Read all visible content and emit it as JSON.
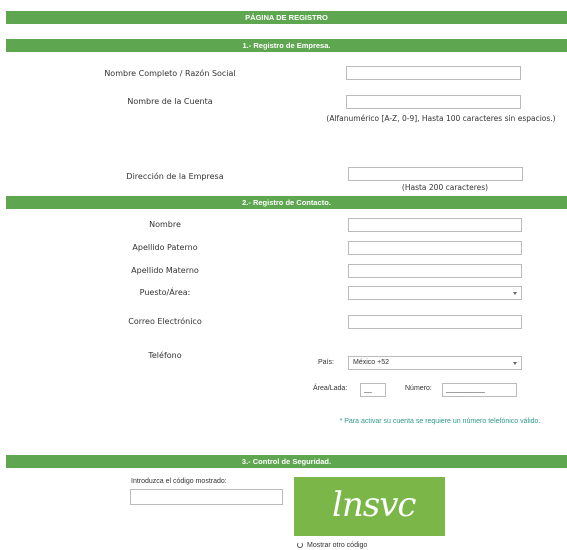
{
  "header": {
    "title": "PÁGINA DE REGISTRO"
  },
  "section1": {
    "title": "1.- Registro de Empresa.",
    "razon_social_label": "Nombre Completo / Razón Social",
    "cuenta_label": "Nombre de la Cuenta",
    "cuenta_hint": "(Alfanumérico [A-Z, 0-9], Hasta 100 caracteres sin espacios.)",
    "direccion_label": "Dirección de la Empresa",
    "direccion_hint": "(Hasta 200 caracteres)"
  },
  "section2": {
    "title": "2.- Registro de Contacto.",
    "nombre_label": "Nombre",
    "paterno_label": "Apellido Paterno",
    "materno_label": "Apellido Materno",
    "puesto_label": "Puesto/Área:",
    "correo_label": "Correo Electrónico",
    "telefono_label": "Teléfono",
    "pais_label": "País:",
    "pais_value": "México +52",
    "area_label": "Área/Lada:",
    "area_value": "__",
    "numero_label": "Número:",
    "numero_value": "__________",
    "activation_note": "* Para activar su cuenta se requiere un número telefónico válido."
  },
  "section3": {
    "title": "3.- Control de Seguridad.",
    "codigo_label": "Introduzca el código mostrado:",
    "captcha_text": "lnsvc",
    "refresh_label": "Mostrar otro código"
  },
  "colors": {
    "accent": "#5fa651",
    "captcha_bg": "#7ab648",
    "note": "#2f9a8a"
  },
  "icons": {
    "refresh": "refresh-icon",
    "dropdown": "chevron-down-icon"
  }
}
